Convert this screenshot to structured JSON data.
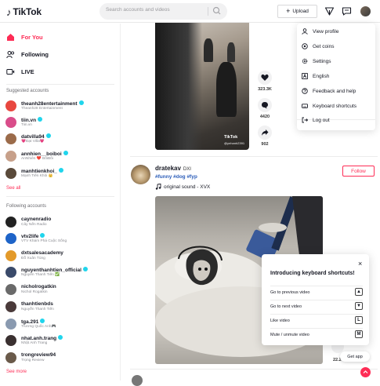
{
  "header": {
    "logo_text": "TikTok",
    "search_placeholder": "Search accounts and videos",
    "upload_label": "Upload"
  },
  "sidebar": {
    "nav": [
      {
        "label": "For You",
        "active": true
      },
      {
        "label": "Following",
        "active": false
      },
      {
        "label": "LIVE",
        "active": false
      }
    ],
    "suggested_title": "Suggested accounts",
    "suggested": [
      {
        "name": "theanh28entertainment",
        "sub": "Theanh28 Entertainment",
        "verified": true,
        "color": "#e8473f"
      },
      {
        "name": "tiin.vn",
        "sub": "Tiin.vn",
        "verified": true,
        "color": "#d94d8a"
      },
      {
        "name": "datvilla94",
        "sub": "💗Đạt Villa💗",
        "verified": true,
        "color": "#9b6b4a"
      },
      {
        "name": "annhien__boiboi",
        "sub": "AnNhiên ❤️ BốiBối",
        "verified": true,
        "color": "#c7a08a"
      },
      {
        "name": "manhtienkhoi_",
        "sub": "Mạnh Tiến Khôi 👑",
        "verified": true,
        "color": "#5a4a3a"
      }
    ],
    "see_all": "See all",
    "following_title": "Following accounts",
    "following": [
      {
        "name": "caynenradio",
        "sub": "Cây Nến Radio",
        "verified": false,
        "color": "#222222"
      },
      {
        "name": "vtv2life",
        "sub": "VTV Khám Phá Cuộc Sống",
        "verified": true,
        "color": "#1e64c8"
      },
      {
        "name": "dxtsalesacademy",
        "sub": "Đỗ Xuân Tùng",
        "verified": false,
        "color": "#e39a2a"
      },
      {
        "name": "nguyenthanhtien_official",
        "sub": "Nguyễn Thanh Tiến ✅",
        "verified": true,
        "color": "#3a4a6a"
      },
      {
        "name": "nicholrogatkin",
        "sub": "Nichol Rogatkin",
        "verified": false,
        "color": "#6a6a6a"
      },
      {
        "name": "thanhtienbds",
        "sub": "Nguyễn Thanh Tiến",
        "verified": false,
        "color": "#4a3a3a"
      },
      {
        "name": "tga.291",
        "sub": "Trương Quốc Anh🎮",
        "verified": true,
        "color": "#8a9ab0"
      },
      {
        "name": "nhat.anh.trang",
        "sub": "Nhật Anh Trang",
        "verified": true,
        "color": "#3a3030"
      },
      {
        "name": "trongreview94",
        "sub": "Trọng Review",
        "verified": false,
        "color": "#6a5a4a"
      }
    ],
    "see_more": "See more"
  },
  "post1": {
    "watermark": "TikTok",
    "watermark_user": "@ynhanh2391",
    "likes": "323.3K",
    "comments": "4420",
    "shares": "902"
  },
  "post2": {
    "username": "dratekav",
    "nickname": "DXI",
    "tags": "#funny #dog #fyp",
    "sound": "original sound - XVX",
    "follow_label": "Follow",
    "partial_count": "22.2"
  },
  "menu": {
    "items": [
      "View profile",
      "Get coins",
      "Settings",
      "English",
      "Feedback and help",
      "Keyboard shortcuts",
      "Log out"
    ]
  },
  "shortcuts": {
    "title": "Introducing keyboard shortcuts!",
    "rows": [
      {
        "label": "Go to previous video",
        "key": "▲"
      },
      {
        "label": "Go to next video",
        "key": "▼"
      },
      {
        "label": "Like video",
        "key": "L"
      },
      {
        "label": "Mute / unmute video",
        "key": "M"
      }
    ]
  },
  "get_app": "Get app"
}
